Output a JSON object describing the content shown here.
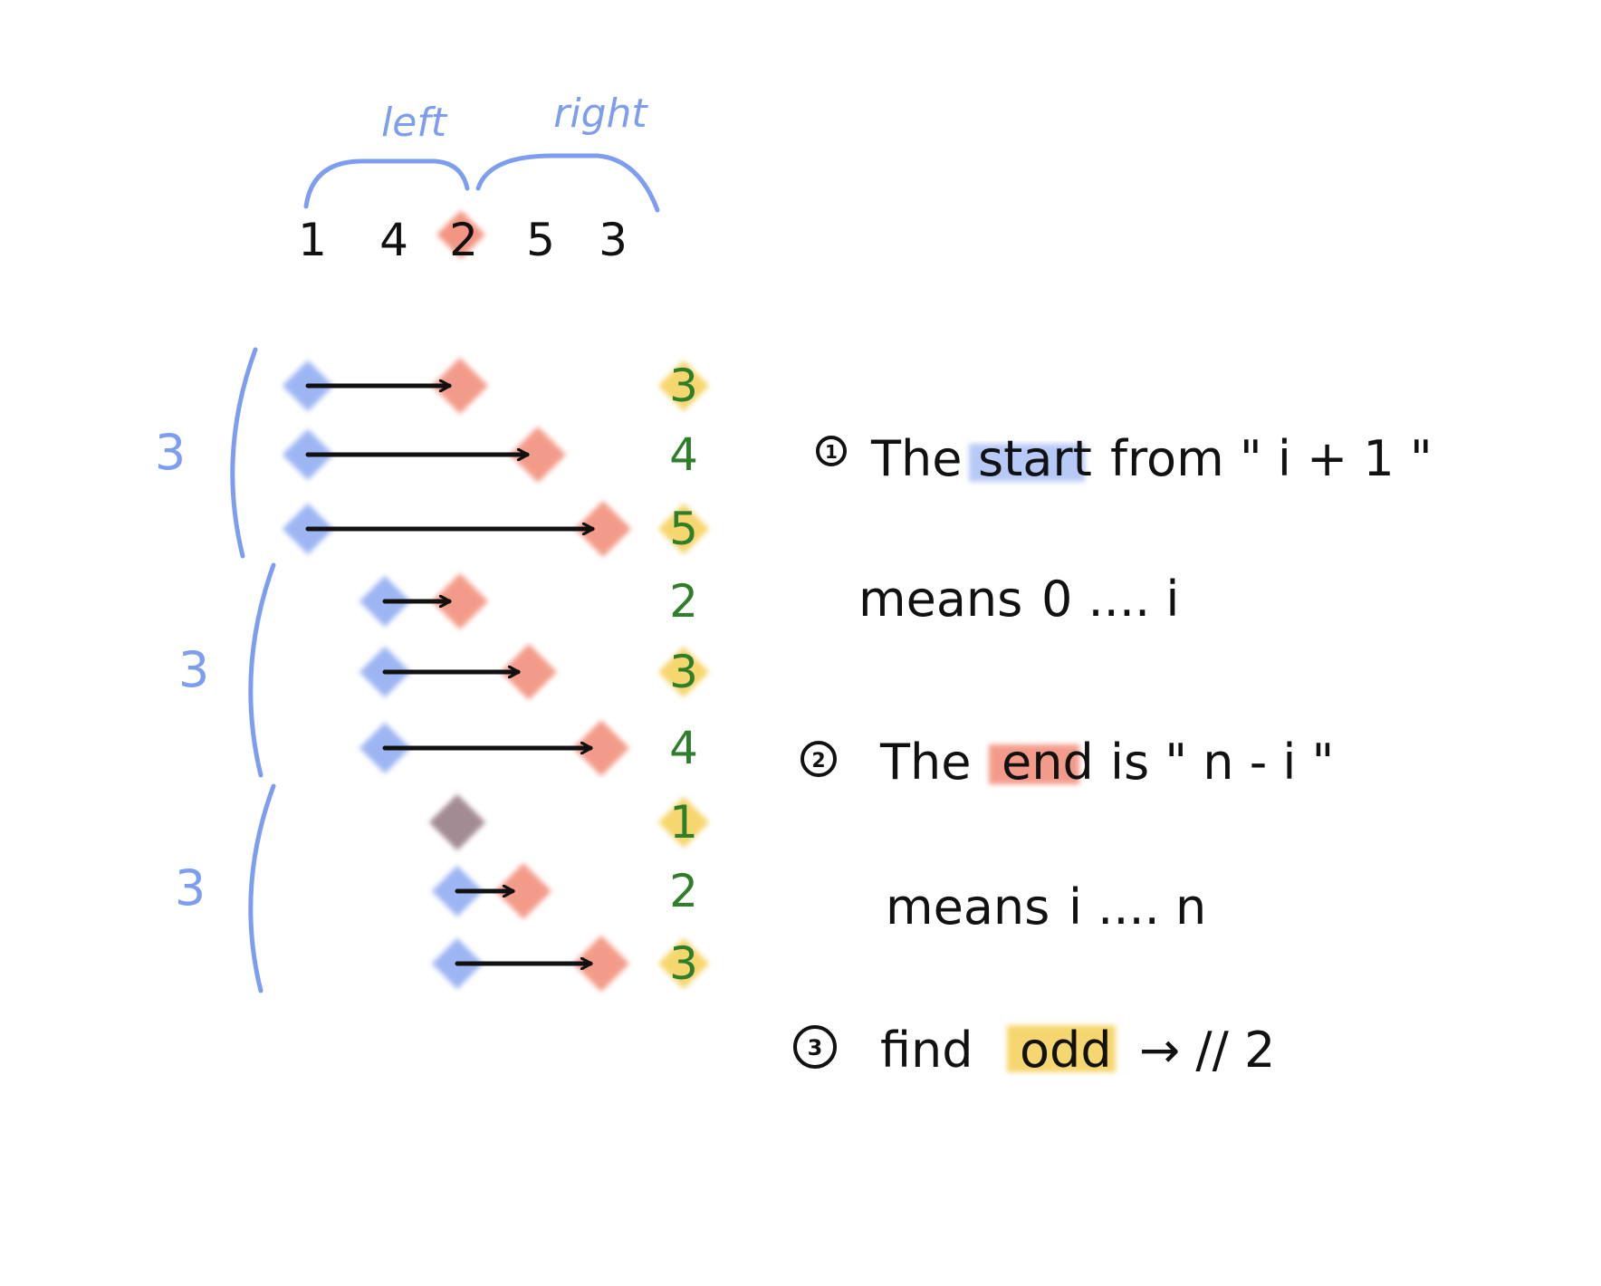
{
  "colors": {
    "blue": "#7d9ef0",
    "red": "#f28a76",
    "yellow": "#f6d25e",
    "green": "#2f7f2a",
    "ink": "#111111",
    "purple": "#9a7f88"
  },
  "header": {
    "left_label": "left",
    "right_label": "right",
    "array": [
      "1",
      "4",
      "2",
      "5",
      "3"
    ],
    "pivot_index": 2
  },
  "groups": [
    {
      "count": "3",
      "rows": [
        {
          "value": "3",
          "highlight": true,
          "arrow": true
        },
        {
          "value": "4",
          "highlight": false,
          "arrow": true
        },
        {
          "value": "5",
          "highlight": true,
          "arrow": true
        }
      ]
    },
    {
      "count": "3",
      "rows": [
        {
          "value": "2",
          "highlight": false,
          "arrow": true
        },
        {
          "value": "3",
          "highlight": true,
          "arrow": true
        },
        {
          "value": "4",
          "highlight": false,
          "arrow": true
        }
      ]
    },
    {
      "count": "3",
      "rows": [
        {
          "value": "1",
          "highlight": true,
          "arrow": false
        },
        {
          "value": "2",
          "highlight": false,
          "arrow": true
        },
        {
          "value": "3",
          "highlight": true,
          "arrow": true
        }
      ]
    }
  ],
  "notes": [
    {
      "number": "①",
      "pre": "The",
      "highlight": "start",
      "post": "from \" i + 1 \""
    },
    {
      "number": "",
      "pre": "means",
      "highlight": "",
      "post": "0 .... i"
    },
    {
      "number": "②",
      "pre": "The",
      "highlight": "end",
      "post": "is \" n - i \""
    },
    {
      "number": "",
      "pre": "means",
      "highlight": "",
      "post": "i .... n"
    },
    {
      "number": "③",
      "pre": "find",
      "highlight": "odd",
      "post": "→ // 2"
    }
  ]
}
